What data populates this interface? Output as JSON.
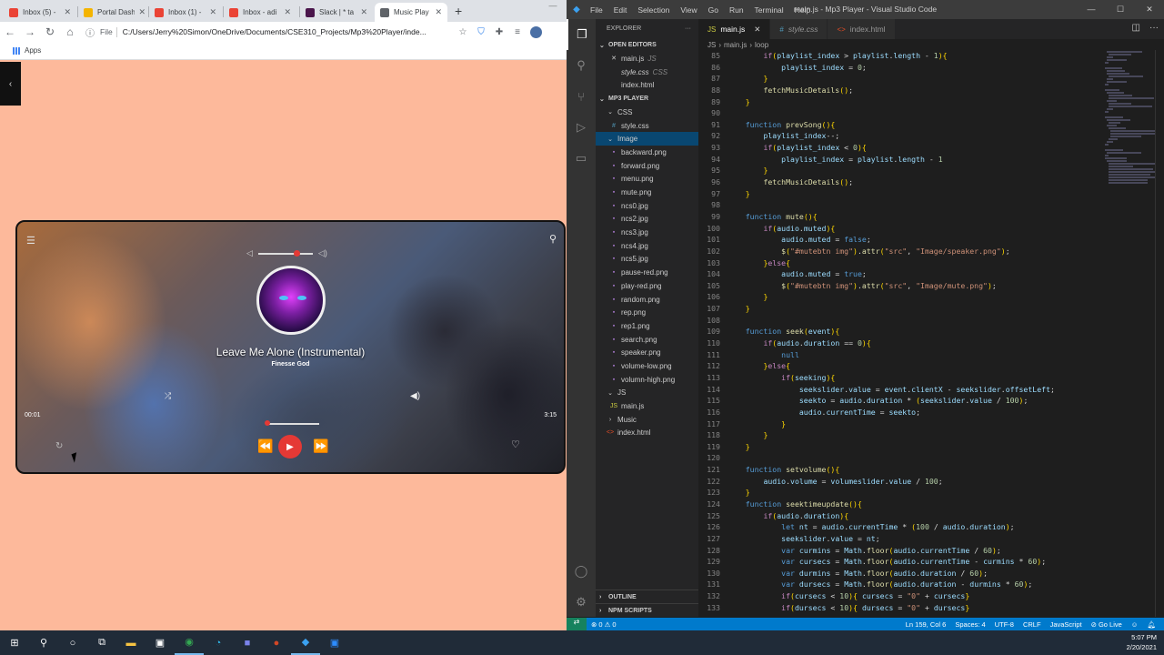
{
  "browser": {
    "tabs": [
      {
        "label": "Inbox (5) -",
        "icon": "gmail-icon",
        "color": "#ea4335"
      },
      {
        "label": "Portal Dash",
        "icon": "portal-icon",
        "color": "#f4b400"
      },
      {
        "label": "Inbox (1) -",
        "icon": "gmail-icon",
        "color": "#ea4335"
      },
      {
        "label": "Inbox - adi",
        "icon": "gmail-icon",
        "color": "#ea4335"
      },
      {
        "label": "Slack | * ta",
        "icon": "slack-icon",
        "color": "#4a154b"
      },
      {
        "label": "Music Play",
        "icon": "globe-icon",
        "color": "#5f6368"
      }
    ],
    "address_scheme": "File",
    "address": "C:/Users/Jerry%20Simon/OneDrive/Documents/CSE310_Projects/Mp3%20Player/inde...",
    "bookmarks_label": "Apps"
  },
  "player": {
    "title": "Leave Me Alone (Instrumental)",
    "artist": "Finesse God",
    "current_time": "00:01",
    "duration": "3:15",
    "volume_fraction": 0.7,
    "seek_fraction": 0.02,
    "accent": "#e53935"
  },
  "vscode": {
    "menu": [
      "File",
      "Edit",
      "Selection",
      "View",
      "Go",
      "Run",
      "Terminal",
      "Help"
    ],
    "window_title": "main.js - Mp3 Player - Visual Studio Code",
    "explorer_label": "EXPLORER",
    "open_editors_label": "OPEN EDITORS",
    "open_editors": [
      {
        "name": "main.js",
        "tag": "JS",
        "close": "✕"
      },
      {
        "name": "style.css",
        "tag": "CSS"
      },
      {
        "name": "index.html",
        "tag": ""
      }
    ],
    "project_label": "MP3 PLAYER",
    "tree": [
      {
        "name": "CSS",
        "depth": 1,
        "type": "folder"
      },
      {
        "name": "style.css",
        "depth": 2,
        "type": "css"
      },
      {
        "name": "Image",
        "depth": 1,
        "type": "folder",
        "selected": true
      },
      {
        "name": "backward.png",
        "depth": 2,
        "type": "img"
      },
      {
        "name": "forward.png",
        "depth": 2,
        "type": "img"
      },
      {
        "name": "menu.png",
        "depth": 2,
        "type": "img"
      },
      {
        "name": "mute.png",
        "depth": 2,
        "type": "img"
      },
      {
        "name": "ncs0.jpg",
        "depth": 2,
        "type": "img"
      },
      {
        "name": "ncs2.jpg",
        "depth": 2,
        "type": "img"
      },
      {
        "name": "ncs3.jpg",
        "depth": 2,
        "type": "img"
      },
      {
        "name": "ncs4.jpg",
        "depth": 2,
        "type": "img"
      },
      {
        "name": "ncs5.jpg",
        "depth": 2,
        "type": "img"
      },
      {
        "name": "pause-red.png",
        "depth": 2,
        "type": "img"
      },
      {
        "name": "play-red.png",
        "depth": 2,
        "type": "img"
      },
      {
        "name": "random.png",
        "depth": 2,
        "type": "img"
      },
      {
        "name": "rep.png",
        "depth": 2,
        "type": "img"
      },
      {
        "name": "rep1.png",
        "depth": 2,
        "type": "img"
      },
      {
        "name": "search.png",
        "depth": 2,
        "type": "img"
      },
      {
        "name": "speaker.png",
        "depth": 2,
        "type": "img"
      },
      {
        "name": "volume-low.png",
        "depth": 2,
        "type": "img"
      },
      {
        "name": "volumn-high.png",
        "depth": 2,
        "type": "img"
      },
      {
        "name": "JS",
        "depth": 1,
        "type": "folder"
      },
      {
        "name": "main.js",
        "depth": 2,
        "type": "js"
      },
      {
        "name": "Music",
        "depth": 1,
        "type": "folder-closed"
      },
      {
        "name": "index.html",
        "depth": 1,
        "type": "html"
      }
    ],
    "outline_label": "OUTLINE",
    "npm_label": "NPM SCRIPTS",
    "tabs": [
      {
        "name": "main.js",
        "icon": "JS",
        "active": true
      },
      {
        "name": "style.css",
        "icon": "#",
        "active": false,
        "italic": true
      },
      {
        "name": "index.html",
        "icon": "<>",
        "active": false
      }
    ],
    "breadcrumb": [
      "JS",
      "›",
      "main.js",
      "›",
      "loop"
    ],
    "code": [
      {
        "n": 85,
        "t": "        if(playlist_index > playlist.length - 1){"
      },
      {
        "n": 86,
        "t": "            playlist_index = 0;"
      },
      {
        "n": 87,
        "t": "        }"
      },
      {
        "n": 88,
        "t": "        fetchMusicDetails();"
      },
      {
        "n": 89,
        "t": "    }"
      },
      {
        "n": 90,
        "t": ""
      },
      {
        "n": 91,
        "t": "    function prevSong(){"
      },
      {
        "n": 92,
        "t": "        playlist_index--;"
      },
      {
        "n": 93,
        "t": "        if(playlist_index < 0){"
      },
      {
        "n": 94,
        "t": "            playlist_index = playlist.length - 1"
      },
      {
        "n": 95,
        "t": "        }"
      },
      {
        "n": 96,
        "t": "        fetchMusicDetails();"
      },
      {
        "n": 97,
        "t": "    }"
      },
      {
        "n": 98,
        "t": ""
      },
      {
        "n": 99,
        "t": "    function mute(){"
      },
      {
        "n": 100,
        "t": "        if(audio.muted){"
      },
      {
        "n": 101,
        "t": "            audio.muted = false;"
      },
      {
        "n": 102,
        "t": "            $(\"#mutebtn img\").attr(\"src\", \"Image/speaker.png\");"
      },
      {
        "n": 103,
        "t": "        }else{"
      },
      {
        "n": 104,
        "t": "            audio.muted = true;"
      },
      {
        "n": 105,
        "t": "            $(\"#mutebtn img\").attr(\"src\", \"Image/mute.png\");"
      },
      {
        "n": 106,
        "t": "        }"
      },
      {
        "n": 107,
        "t": "    }"
      },
      {
        "n": 108,
        "t": ""
      },
      {
        "n": 109,
        "t": "    function seek(event){"
      },
      {
        "n": 110,
        "t": "        if(audio.duration == 0){"
      },
      {
        "n": 111,
        "t": "            null"
      },
      {
        "n": 112,
        "t": "        }else{"
      },
      {
        "n": 113,
        "t": "            if(seeking){"
      },
      {
        "n": 114,
        "t": "                seekslider.value = event.clientX - seekslider.offsetLeft;"
      },
      {
        "n": 115,
        "t": "                seekto = audio.duration * (seekslider.value / 100);"
      },
      {
        "n": 116,
        "t": "                audio.currentTime = seekto;"
      },
      {
        "n": 117,
        "t": "            }"
      },
      {
        "n": 118,
        "t": "        }"
      },
      {
        "n": 119,
        "t": "    }"
      },
      {
        "n": 120,
        "t": ""
      },
      {
        "n": 121,
        "t": "    function setvolume(){"
      },
      {
        "n": 122,
        "t": "        audio.volume = volumeslider.value / 100;"
      },
      {
        "n": 123,
        "t": "    }"
      },
      {
        "n": 124,
        "t": "    function seektimeupdate(){"
      },
      {
        "n": 125,
        "t": "        if(audio.duration){"
      },
      {
        "n": 126,
        "t": "            let nt = audio.currentTime * (100 / audio.duration);"
      },
      {
        "n": 127,
        "t": "            seekslider.value = nt;"
      },
      {
        "n": 128,
        "t": "            var curmins = Math.floor(audio.currentTime / 60);"
      },
      {
        "n": 129,
        "t": "            var cursecs = Math.floor(audio.currentTime - curmins * 60);"
      },
      {
        "n": 130,
        "t": "            var durmins = Math.floor(audio.duration / 60);"
      },
      {
        "n": 131,
        "t": "            var dursecs = Math.floor(audio.duration - durmins * 60);"
      },
      {
        "n": 132,
        "t": "            if(cursecs < 10){ cursecs = \"0\" + cursecs}"
      },
      {
        "n": 133,
        "t": "            if(dursecs < 10){ dursecs = \"0\" + dursecs}"
      }
    ],
    "status": {
      "errors": "⊗ 0 ⚠ 0",
      "position": "Ln 159, Col 6",
      "spaces": "Spaces: 4",
      "encoding": "UTF-8",
      "eol": "CRLF",
      "language": "JavaScript",
      "golive": "⊘ Go Live"
    }
  },
  "taskbar": {
    "time": "5:07 PM",
    "date": "2/20/2021"
  }
}
